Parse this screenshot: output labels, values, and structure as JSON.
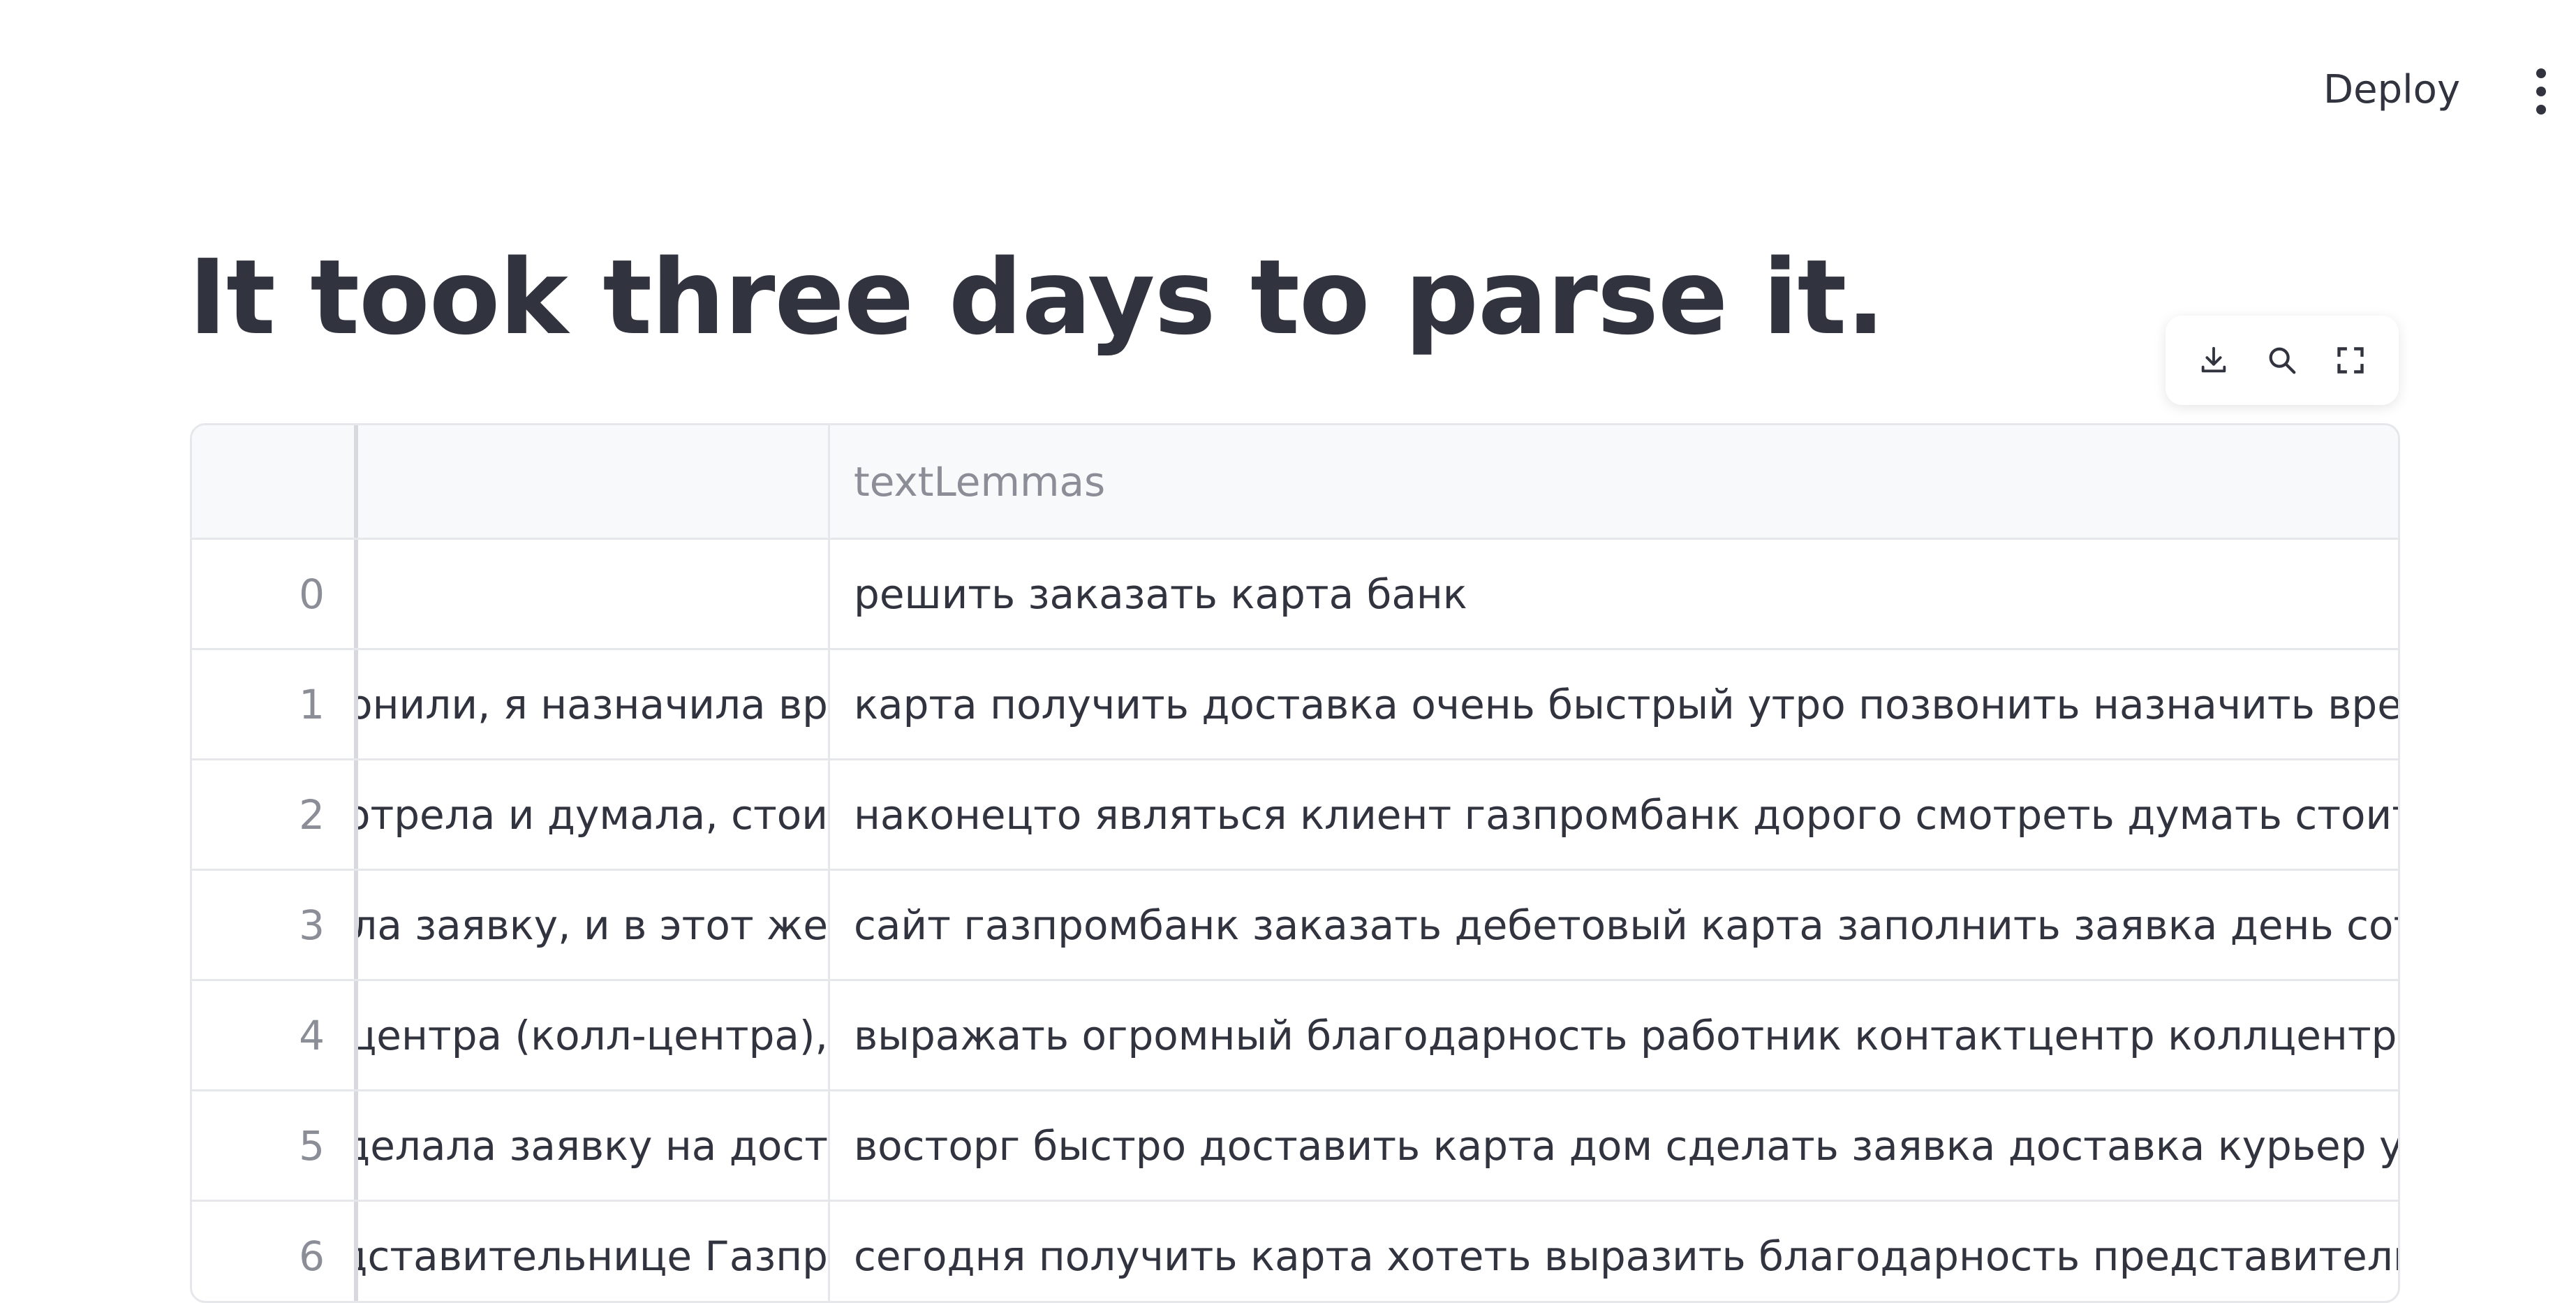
{
  "header": {
    "deploy_label": "Deploy",
    "menu_icon": "more-vertical-icon"
  },
  "main": {
    "title": "It took three days to parse it."
  },
  "toolbar": {
    "icons": [
      "download-icon",
      "search-icon",
      "fullscreen-icon"
    ]
  },
  "table": {
    "columns": [
      "",
      "",
      "textLemmas"
    ],
    "rows": [
      {
        "index": "0",
        "text": "",
        "lemmas": "решить заказать карта банк"
      },
      {
        "index": "1",
        "text": "эзвонили, я назначила вр",
        "lemmas": "карта получить доставка очень быстрый утро позвонить назначить время преде"
      },
      {
        "index": "2",
        "text": "смотрела и думала, стои",
        "lemmas": "наконецто являться клиент газпромбанк дорого смотреть думать стоить получа"
      },
      {
        "index": "3",
        "text": "олнила заявку, и в этот же",
        "lemmas": "сайт газпромбанк заказать дебетовый карта заполнить заявка день сотрудник с"
      },
      {
        "index": "4",
        "text": "кт-центра (колл-центра),",
        "lemmas": "выражать огромный благодарность работник контактцентр коллцентр оказать"
      },
      {
        "index": "5",
        "text": "і. Сделала заявку на дост",
        "lemmas": "восторг быстро доставить карта дом сделать заявка доставка курьер удобный в"
      },
      {
        "index": "6",
        "text": "редставительнице Газпр",
        "lemmas": "сегодня получить карта хотеть выразить благодарность представительница газ"
      }
    ]
  }
}
